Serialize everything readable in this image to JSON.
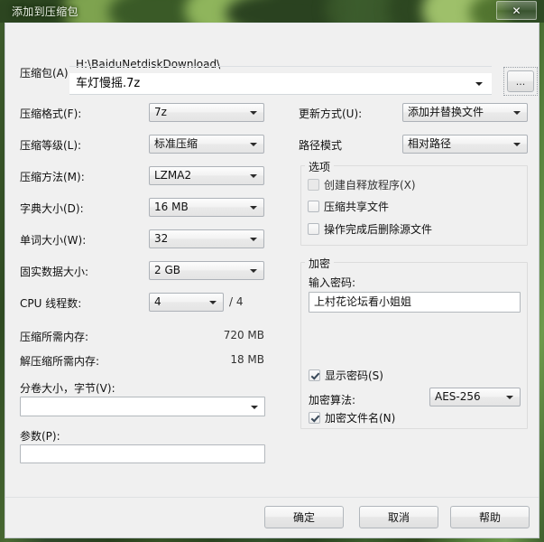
{
  "window": {
    "title": "添加到压缩包",
    "close_label": "✕"
  },
  "archive": {
    "label": "压缩包(A)",
    "path": "H:\\BaiduNetdiskDownload\\",
    "filename": "车灯慢摇.7z",
    "browse_label": "..."
  },
  "left": {
    "format_label": "压缩格式(F):",
    "format_value": "7z",
    "level_label": "压缩等级(L):",
    "level_value": "标准压缩",
    "method_label": "压缩方法(M):",
    "method_value": "LZMA2",
    "dict_label": "字典大小(D):",
    "dict_value": "16 MB",
    "word_label": "单词大小(W):",
    "word_value": "32",
    "solid_label": "固实数据大小:",
    "solid_value": "2 GB",
    "threads_label": "CPU 线程数:",
    "threads_value": "4",
    "threads_max": "/ 4",
    "mem_compress_label": "压缩所需内存:",
    "mem_compress_value": "720 MB",
    "mem_decompress_label": "解压缩所需内存:",
    "mem_decompress_value": "18 MB",
    "volume_label": "分卷大小，字节(V):",
    "volume_value": "",
    "params_label": "参数(P):",
    "params_value": ""
  },
  "right": {
    "update_label": "更新方式(U):",
    "update_value": "添加并替换文件",
    "path_mode_label": "路径模式",
    "path_mode_value": "相对路径",
    "options": {
      "title": "选项",
      "items": [
        {
          "label": "创建自释放程序(X)",
          "checked": false,
          "disabled": true
        },
        {
          "label": "压缩共享文件",
          "checked": false,
          "disabled": false
        },
        {
          "label": "操作完成后删除源文件",
          "checked": false,
          "disabled": false
        }
      ]
    },
    "encryption": {
      "title": "加密",
      "password_label": "输入密码:",
      "password_value": "上村花论坛看小姐姐",
      "show_password_label": "显示密码(S)",
      "show_password_checked": true,
      "algorithm_label": "加密算法:",
      "algorithm_value": "AES-256",
      "encrypt_names_label": "加密文件名(N)",
      "encrypt_names_checked": true
    }
  },
  "buttons": {
    "ok": "确定",
    "cancel": "取消",
    "help": "帮助"
  },
  "colors": {
    "dialog_bg": "#f0f0f0",
    "titlebar_green": "#35512a",
    "text": "#111111"
  }
}
